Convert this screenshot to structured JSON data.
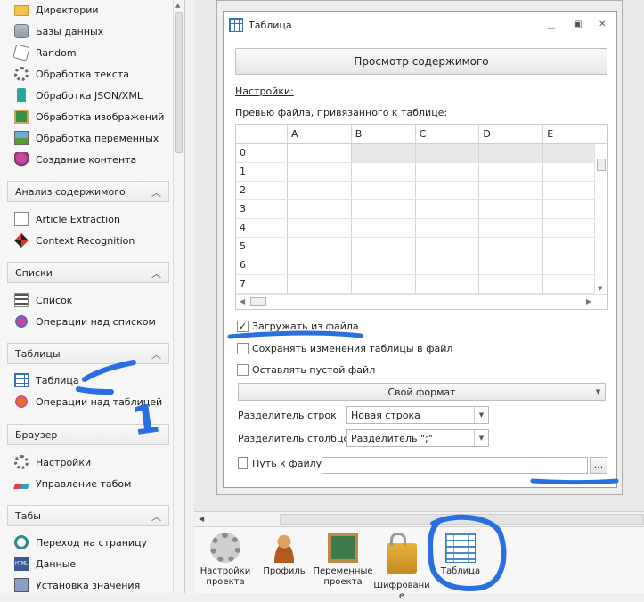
{
  "sidebar": {
    "items_top": [
      {
        "label": "Директории",
        "icon": "folder-icon"
      },
      {
        "label": "Базы данных",
        "icon": "database-icon"
      },
      {
        "label": "Random",
        "icon": "dice-icon"
      },
      {
        "label": "Обработка текста",
        "icon": "gear-icon"
      },
      {
        "label": "Обработка JSON/XML",
        "icon": "document-icon"
      },
      {
        "label": "Обработка изображений",
        "icon": "image-icon"
      },
      {
        "label": "Обработка переменных",
        "icon": "variables-icon"
      },
      {
        "label": "Создание контента",
        "icon": "content-icon"
      }
    ],
    "groups": {
      "content_analysis": {
        "title": "Анализ содержимого",
        "items": [
          "Article Extraction",
          "Context Recognition"
        ]
      },
      "lists": {
        "title": "Списки",
        "items": [
          "Список",
          "Операции над списком"
        ]
      },
      "tables": {
        "title": "Таблицы",
        "items": [
          "Таблица",
          "Операции над таблицей"
        ]
      },
      "browser": {
        "title": "Браузер",
        "items": [
          "Настройки",
          "Управление табом"
        ]
      },
      "tabs": {
        "title": "Табы",
        "items": [
          "Переход на страницу",
          "Данные",
          "Установка значения"
        ]
      }
    }
  },
  "panel": {
    "title": "Таблица",
    "view_button": "Просмотр содержимого",
    "settings_label": "Настройки:",
    "preview_label": "Превью файла, привязанного к таблице:",
    "grid": {
      "columns": [
        "A",
        "B",
        "C",
        "D",
        "E"
      ],
      "rows": [
        "0",
        "1",
        "2",
        "3",
        "4",
        "5",
        "6",
        "7"
      ]
    },
    "checkboxes": [
      {
        "label": "Загружать из файла",
        "checked": true
      },
      {
        "label": "Сохранять изменения таблицы в файл",
        "checked": false
      },
      {
        "label": "Оставлять пустой файл",
        "checked": false
      }
    ],
    "format_select": "Свой формат",
    "row_separator": {
      "label": "Разделитель строк",
      "value": "Новая строка"
    },
    "col_separator": {
      "label": "Разделитель столбцов",
      "value": "Разделитель \";\""
    },
    "file_path": {
      "label": "Путь к файлу",
      "value": "",
      "browse": "..."
    }
  },
  "toolbar": {
    "tools": [
      {
        "label": "Настройки проекта",
        "icon": "settings-gear-icon"
      },
      {
        "label": "Профиль",
        "icon": "profile-icon"
      },
      {
        "label": "Переменные проекта",
        "icon": "variables-board-icon"
      },
      {
        "label": "Шифровани е",
        "icon": "lock-icon"
      },
      {
        "label": "Таблица",
        "icon": "table-icon"
      }
    ]
  },
  "annotations": {
    "number": "1",
    "color": "#2a6fe0"
  }
}
